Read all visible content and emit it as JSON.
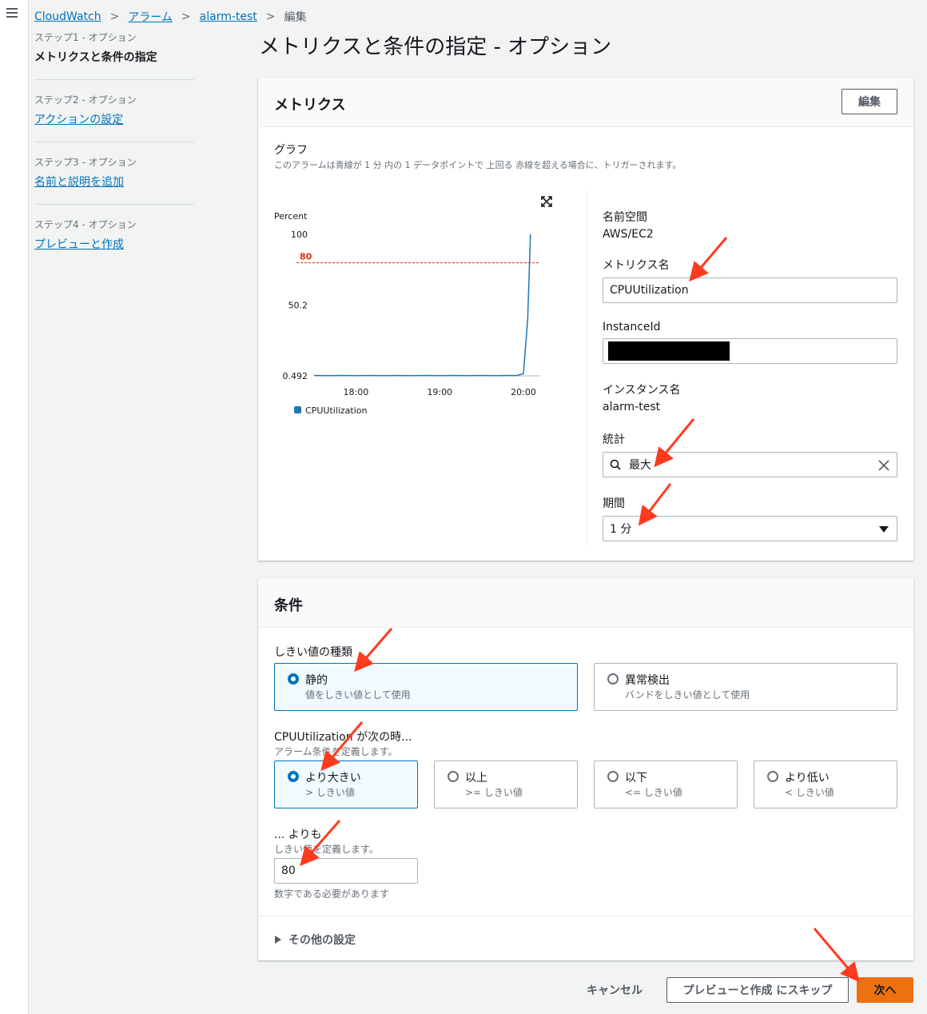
{
  "breadcrumb": {
    "items": [
      "CloudWatch",
      "アラーム",
      "alarm-test"
    ],
    "current": "編集"
  },
  "steps": [
    {
      "num": "ステップ1 - オプション",
      "label": "メトリクスと条件の指定"
    },
    {
      "num": "ステップ2 - オプション",
      "label": "アクションの設定"
    },
    {
      "num": "ステップ3 - オプション",
      "label": "名前と説明を追加"
    },
    {
      "num": "ステップ4 - オプション",
      "label": "プレビューと作成"
    }
  ],
  "page_title": "メトリクスと条件の指定 - オプション",
  "metrics_panel": {
    "title": "メトリクス",
    "edit_label": "編集",
    "graph_label": "グラフ",
    "graph_desc": "このアラームは青線が 1 分 内の 1 データポイントで 上回る 赤線を超える場合に、トリガーされます。",
    "namespace_label": "名前空間",
    "namespace_value": "AWS/EC2",
    "metric_name_label": "メトリクス名",
    "metric_name_value": "CPUUtilization",
    "instanceid_label": "InstanceId",
    "instance_name_label": "インスタンス名",
    "instance_name_value": "alarm-test",
    "statistic_label": "統計",
    "statistic_value": "最大",
    "period_label": "期間",
    "period_value": "1 分"
  },
  "chart_data": {
    "type": "line",
    "ylabel": "Percent",
    "y_ticks": [
      "100",
      "50.2",
      "0.492"
    ],
    "x_ticks": [
      "18:00",
      "19:00",
      "20:00"
    ],
    "ylim": [
      0.492,
      100
    ],
    "threshold": 80,
    "threshold_label": "80",
    "series": [
      {
        "name": "CPUUtilization",
        "x": [
          "17:30",
          "17:40",
          "17:50",
          "18:00",
          "18:10",
          "18:20",
          "18:30",
          "18:40",
          "18:50",
          "19:00",
          "19:10",
          "19:20",
          "19:30",
          "19:40",
          "19:50",
          "19:55",
          "20:00",
          "20:03",
          "20:05"
        ],
        "values": [
          0.8,
          0.6,
          0.8,
          0.6,
          0.8,
          0.6,
          0.8,
          0.6,
          0.8,
          0.6,
          0.8,
          0.6,
          0.8,
          0.6,
          0.8,
          0.7,
          2,
          40,
          100
        ]
      }
    ]
  },
  "conditions_panel": {
    "title": "条件",
    "threshold_type_label": "しきい値の種類",
    "threshold_types": [
      {
        "title": "静的",
        "sub": "値をしきい値として使用"
      },
      {
        "title": "異常検出",
        "sub": "バンドをしきい値として使用"
      }
    ],
    "when_label": "CPUUtilization が次の時...",
    "when_desc": "アラーム条件を定義します。",
    "operators": [
      {
        "title": "より大きい",
        "sub": "> しきい値"
      },
      {
        "title": "以上",
        "sub": ">= しきい値"
      },
      {
        "title": "以下",
        "sub": "<= しきい値"
      },
      {
        "title": "より低い",
        "sub": "< しきい値"
      }
    ],
    "than_label": "... よりも",
    "than_desc": "しきい値を定義します。",
    "threshold_value": "80",
    "threshold_hint": "数字である必要があります",
    "other_settings": "その他の設定"
  },
  "footer": {
    "cancel": "キャンセル",
    "skip": "プレビューと作成 にスキップ",
    "next": "次へ"
  },
  "colors": {
    "link": "#0073bb",
    "primary": "#ec7211",
    "arrow": "#ff3b1f",
    "line": "#1f77b4",
    "threshold": "#d13212"
  }
}
